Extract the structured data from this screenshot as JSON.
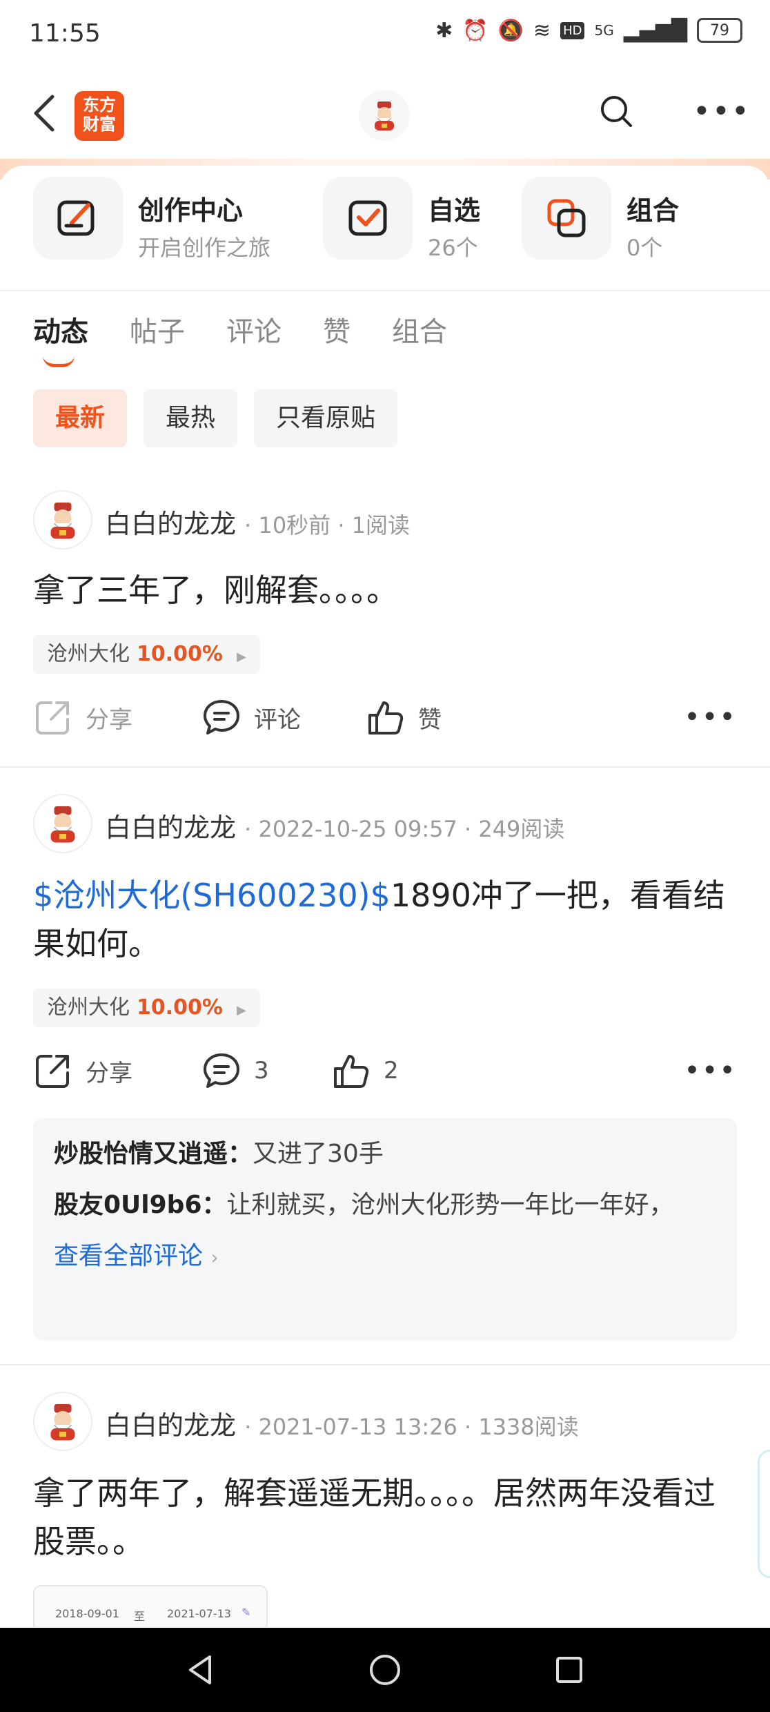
{
  "status_bar": {
    "time": "11:55",
    "battery": "79",
    "network": "5G",
    "hd": "HD"
  },
  "header": {
    "logo_text_line1": "东方",
    "logo_text_line2": "财富"
  },
  "shortcuts": [
    {
      "title": "创作中心",
      "subtitle": "开启创作之旅",
      "icon": "pencil-edit-icon"
    },
    {
      "title": "自选",
      "subtitle": "26个",
      "icon": "checkbox-icon"
    },
    {
      "title": "组合",
      "subtitle": "0个",
      "icon": "portfolio-icon"
    }
  ],
  "tabs": [
    "动态",
    "帖子",
    "评论",
    "赞",
    "组合"
  ],
  "filters": [
    "最新",
    "最热",
    "只看原贴"
  ],
  "posts": [
    {
      "author": "白白的龙龙",
      "meta": "· 10秒前 · 1阅读",
      "content": "拿了三年了，刚解套。。。。",
      "stock": "沧州大化",
      "stock_pct": "10.00%",
      "share": "分享",
      "comment": "评论",
      "like": "赞"
    },
    {
      "author": "白白的龙龙",
      "meta": "· 2022-10-25 09:57 · 249阅读",
      "content_link": "$沧州大化(SH600230)$",
      "content": "1890冲了一把，看看结果如何。",
      "stock": "沧州大化",
      "stock_pct": "10.00%",
      "share": "分享",
      "comment": "3",
      "like": "2",
      "comments": [
        {
          "name": "炒股怡情又逍遥：",
          "text": "又进了30手"
        },
        {
          "name": "股友0Ul9b6：",
          "text": "让利就买，沧州大化形势一年比一年好，"
        }
      ],
      "view_all": "查看全部评论"
    },
    {
      "author": "白白的龙龙",
      "meta": "· 2021-07-13 13:26 · 1338阅读",
      "content": "拿了两年了，解套遥遥无期。。。。居然两年没看过股票。。",
      "thumb_dates": [
        "2018-09-01",
        "至",
        "2021-07-13"
      ]
    }
  ]
}
